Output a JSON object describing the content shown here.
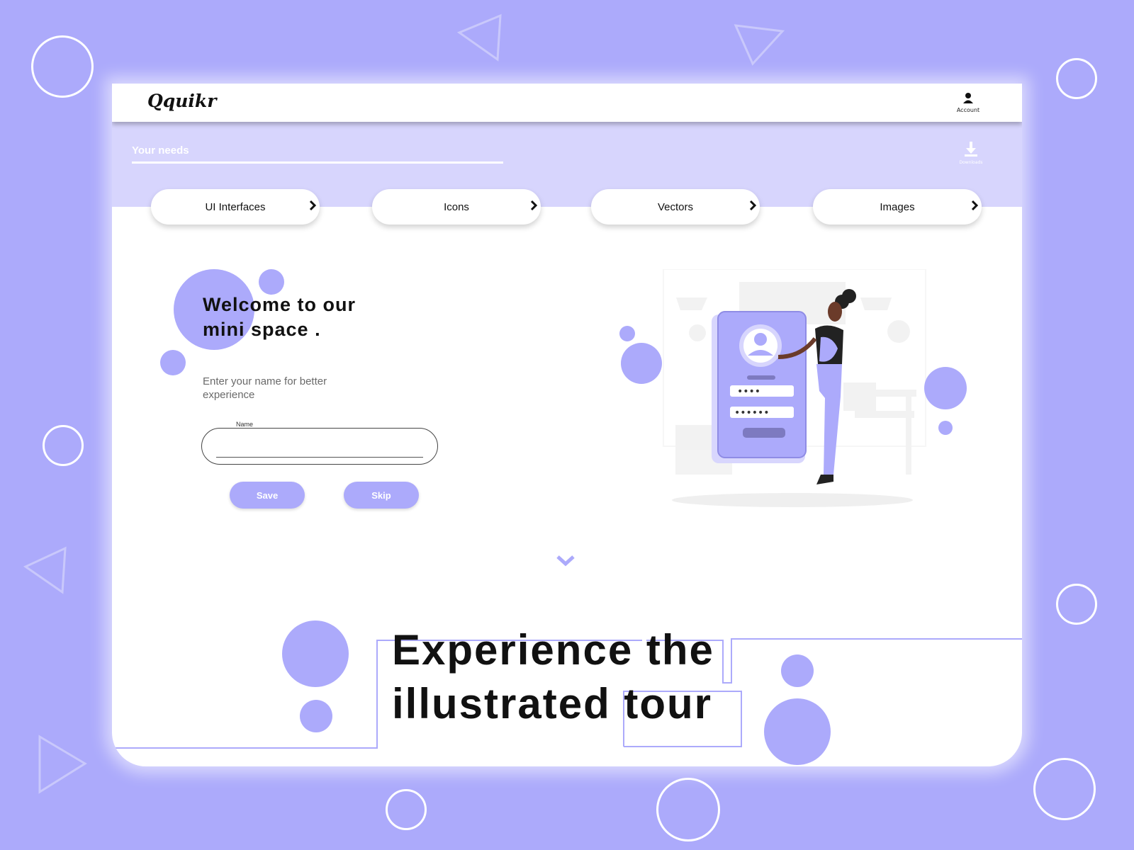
{
  "colors": {
    "accent": "#acaafb",
    "band": "#d7d5fd",
    "white": "#ffffff"
  },
  "header": {
    "logo": "Qquikr",
    "account_label": "Account",
    "account_icon": "user-icon"
  },
  "search": {
    "label": "Your needs"
  },
  "download": {
    "label": "Downloads",
    "icon": "download-icon"
  },
  "categories": [
    {
      "label": "UI Interfaces"
    },
    {
      "label": "Icons"
    },
    {
      "label": "Vectors"
    },
    {
      "label": "Images"
    }
  ],
  "welcome": {
    "line1": "Welcome to our",
    "line2": "mini space .",
    "subtext": "Enter your name for better experience"
  },
  "form": {
    "name_label": "Name",
    "name_value": "",
    "save_label": "Save",
    "skip_label": "Skip"
  },
  "illustration": {
    "pin_dots": "••••",
    "password_dots": "••••••"
  },
  "tour": {
    "line1": "Experience the",
    "line2": "illustrated tour"
  }
}
